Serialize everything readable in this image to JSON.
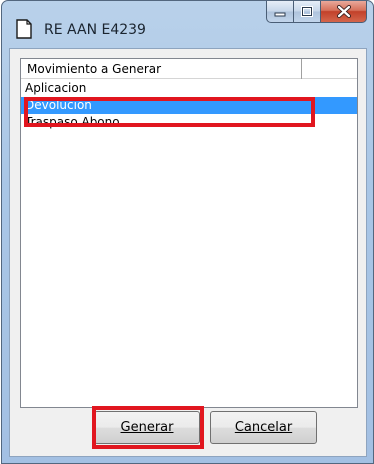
{
  "window": {
    "title": "RE AAN E4239"
  },
  "list": {
    "column_header": "Movimiento a Generar",
    "items": [
      {
        "label": "Aplicacion",
        "selected": false
      },
      {
        "label": "Devolucion",
        "selected": true
      },
      {
        "label": "Traspaso Abono",
        "selected": false
      }
    ]
  },
  "buttons": {
    "generar": "Generar",
    "cancelar": "Cancelar"
  },
  "colors": {
    "selection": "#3399ff",
    "highlight_frame": "#e1161f"
  }
}
